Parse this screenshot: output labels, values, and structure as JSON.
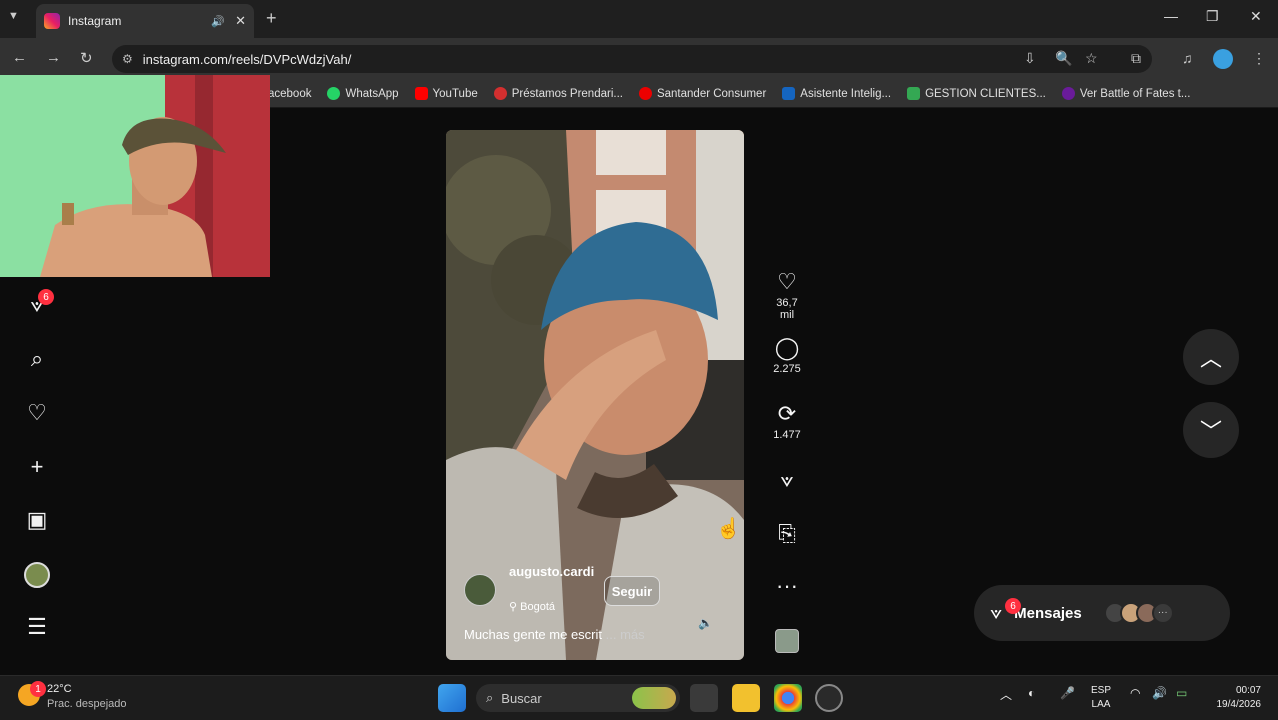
{
  "browser": {
    "tab_title": "Instagram",
    "url": "instagram.com/reels/DVPcWdzjVah/",
    "bookmarks": [
      {
        "label": "acebook",
        "color": "#1877f2"
      },
      {
        "label": "WhatsApp",
        "color": "#25d366"
      },
      {
        "label": "YouTube",
        "color": "#ff0000"
      },
      {
        "label": "Préstamos Prendari...",
        "color": "#d32f2f"
      },
      {
        "label": "Santander Consumer",
        "color": "#ec0000"
      },
      {
        "label": "Asistente Intelig...",
        "color": "#1565c0"
      },
      {
        "label": "GESTION CLIENTES...",
        "color": "#34a853"
      },
      {
        "label": "Ver Battle of Fates t...",
        "color": "#6a1b9a"
      }
    ]
  },
  "sidebar": {
    "notifications_badge": "6"
  },
  "reel": {
    "username": "augusto.cardi",
    "location": "Bogotá",
    "follow_label": "Seguir",
    "caption": "Muchas gente me escrit",
    "more_label": "... más"
  },
  "actions": {
    "likes": "36,7 mil",
    "comments": "2.275",
    "reposts": "1.477"
  },
  "messages": {
    "label": "Mensajes",
    "badge": "6"
  },
  "taskbar": {
    "weather_temp": "22°C",
    "weather_desc": "Prac. despejado",
    "weather_badge": "1",
    "search_label": "Buscar",
    "lang_top": "ESP",
    "lang_bottom": "LAA",
    "time": "00:07",
    "date": "19/4/2026"
  }
}
